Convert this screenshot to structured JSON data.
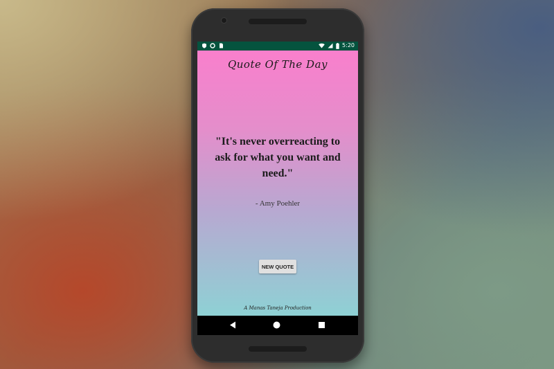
{
  "status_bar": {
    "time": "5:20",
    "left_icons": [
      "shield-icon",
      "circle-icon",
      "sim-card-icon"
    ],
    "right_icons": [
      "wifi-icon",
      "signal-icon",
      "battery-icon"
    ],
    "background": "#05533e"
  },
  "app": {
    "title": "Quote Of The Day",
    "quote": "\"It's never overreacting to ask for what you want and need.\"",
    "author": "- Amy Poehler",
    "new_quote_button": "NEW QUOTE",
    "footer": "A Manas Taneja Production",
    "gradient_top": "#f97fcc",
    "gradient_bottom": "#8ed1d4"
  },
  "navigation_bar": {
    "buttons": [
      "back-icon",
      "home-icon",
      "recents-icon"
    ]
  }
}
